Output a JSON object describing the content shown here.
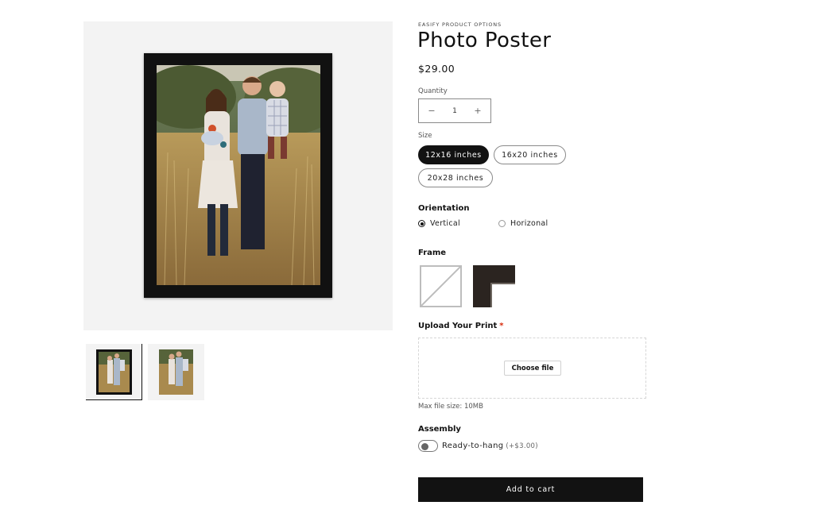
{
  "product": {
    "vendor": "EASIFY PRODUCT OPTIONS",
    "title": "Photo Poster",
    "price": "$29.00"
  },
  "quantity": {
    "label": "Quantity",
    "value": "1",
    "decrease_icon": "minus-icon",
    "increase_icon": "plus-icon",
    "decrease_symbol": "−",
    "increase_symbol": "+"
  },
  "size": {
    "label": "Size",
    "options": [
      "12x16 inches",
      "16x20 inches",
      "20x28 inches"
    ],
    "selected": "12x16 inches"
  },
  "orientation": {
    "label": "Orientation",
    "options": [
      "Vertical",
      "Horizonal"
    ],
    "selected": "Vertical"
  },
  "frame": {
    "label": "Frame",
    "swatches": [
      "none",
      "black"
    ]
  },
  "upload": {
    "label": "Upload Your Print",
    "required_mark": "*",
    "button": "Choose file",
    "note": "Max file size: 10MB"
  },
  "assembly": {
    "label": "Assembly",
    "option": "Ready-to-hang",
    "extra": "(+$3.00)",
    "enabled": false
  },
  "cart": {
    "button": "Add to cart"
  },
  "colors": {
    "primary": "#121212",
    "background": "#ffffff",
    "media_bg": "#f3f3f3",
    "required": "#d72c0d",
    "frame_black": "#2b2420"
  }
}
